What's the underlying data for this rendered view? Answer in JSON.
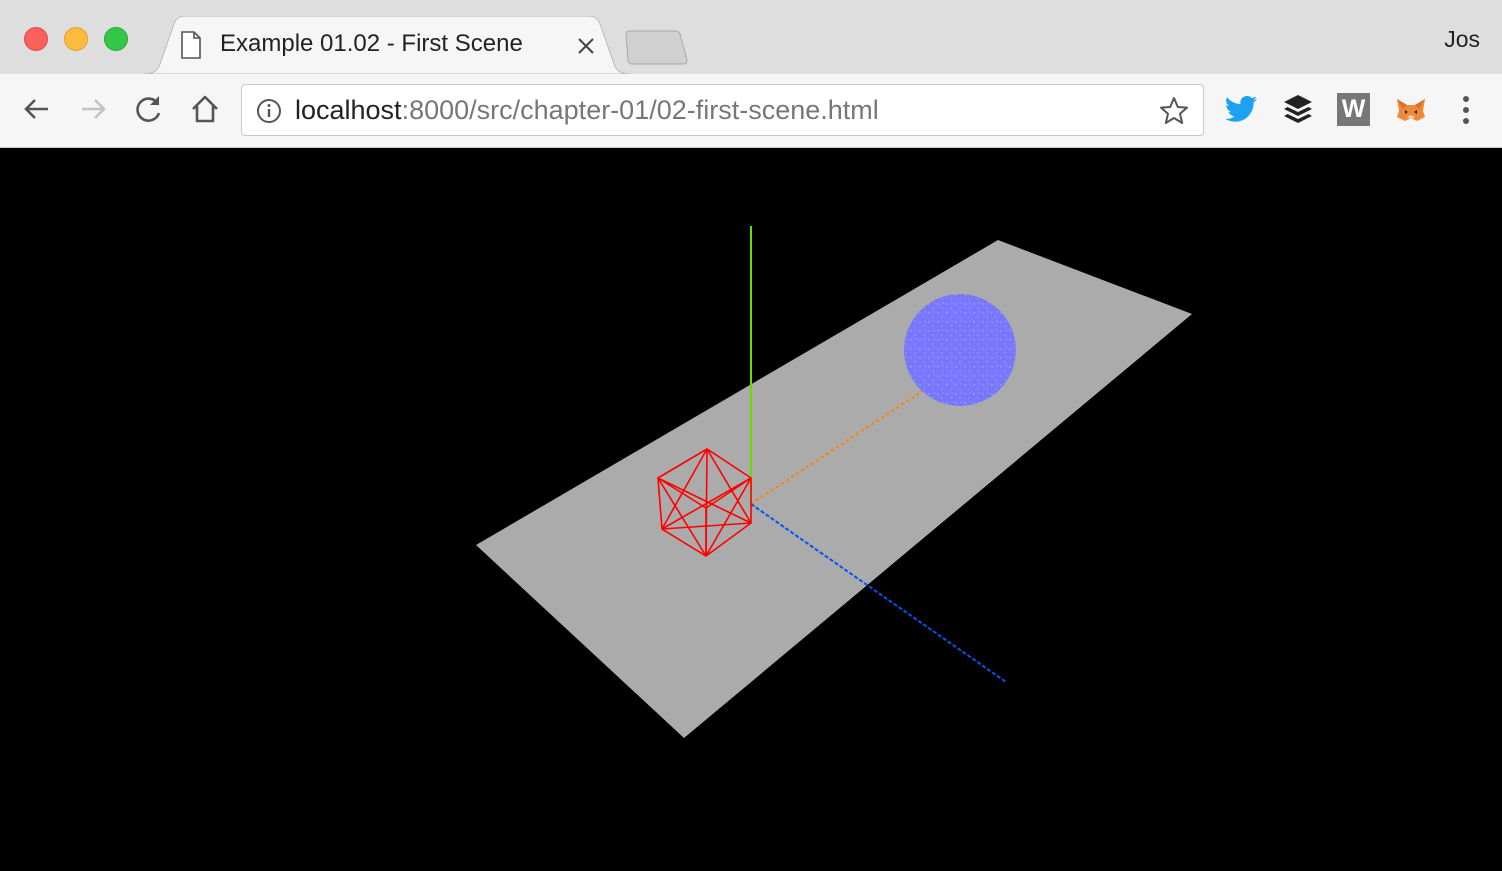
{
  "window": {
    "profile_name": "Jos",
    "traffic_lights": {
      "close": "#fc605c",
      "minimize": "#fdbc40",
      "maximize": "#34c84a"
    }
  },
  "tab": {
    "title": "Example 01.02 - First Scene",
    "icon": "document-icon"
  },
  "address_bar": {
    "url_host": "localhost",
    "url_rest": ":8000/src/chapter-01/02-first-scene.html"
  },
  "toolbar": {
    "icons": [
      "back-icon",
      "forward-icon",
      "reload-icon",
      "home-icon",
      "info-icon",
      "bookmark-star-icon"
    ],
    "extensions": [
      "twitter-icon",
      "buffer-icon",
      "w-extension-icon",
      "metamask-icon",
      "menu-icon"
    ],
    "w_extension_letter": "W"
  },
  "scene": {
    "background": "#000000",
    "plane_color": "#ababab",
    "cube_color": "#ff0000",
    "sphere_color": "#7777ff",
    "axes": {
      "x": "#ff8000",
      "y": "#66dd00",
      "z": "#0055ee"
    }
  }
}
